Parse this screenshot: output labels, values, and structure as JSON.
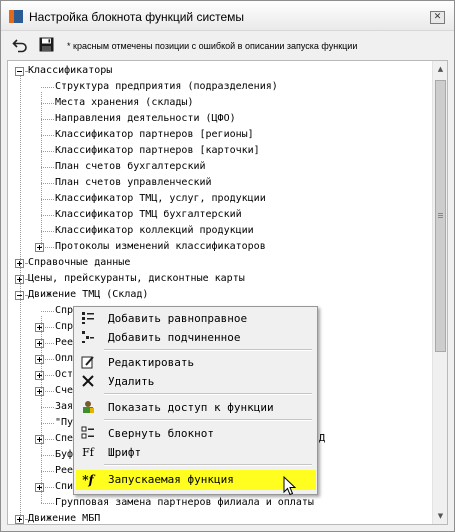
{
  "window": {
    "title": "Настройка блокнота функций системы",
    "close_glyph": "✕"
  },
  "toolbar": {
    "undo_icon": "undo-icon",
    "save_icon": "floppy-disk-icon",
    "hint": "* красным отмечены позиции с ошибкой в описании запуска функции"
  },
  "tree": {
    "items": [
      {
        "label": "Классификаторы",
        "level": 0,
        "expander": "minus"
      },
      {
        "label": "Структура предприятия (подразделения)",
        "level": 1,
        "expander": "none"
      },
      {
        "label": "Места хранения (склады)",
        "level": 1,
        "expander": "none"
      },
      {
        "label": "Направления деятельности (ЦФО)",
        "level": 1,
        "expander": "none"
      },
      {
        "label": "Классификатор партнеров [регионы]",
        "level": 1,
        "expander": "none"
      },
      {
        "label": "Классификатор партнеров [карточки]",
        "level": 1,
        "expander": "none"
      },
      {
        "label": "План счетов бухгалтерский",
        "level": 1,
        "expander": "none"
      },
      {
        "label": "План счетов управленческий",
        "level": 1,
        "expander": "none"
      },
      {
        "label": "Классификатор ТМЦ, услуг, продукции",
        "level": 1,
        "expander": "none"
      },
      {
        "label": "Классификатор ТМЦ бухгалтерский",
        "level": 1,
        "expander": "none"
      },
      {
        "label": "Классификатор коллекций продукции",
        "level": 1,
        "expander": "none"
      },
      {
        "label": "Протоколы изменений классификаторов",
        "level": 1,
        "expander": "plus"
      },
      {
        "label": "Справочные данные",
        "level": 0,
        "expander": "plus"
      },
      {
        "label": "Цены, прейскуранты, дисконтные карты",
        "level": 0,
        "expander": "plus"
      },
      {
        "label": "Движение ТМЦ (Склад)",
        "level": 0,
        "expander": "minus"
      },
      {
        "label": "Спр",
        "level": 1,
        "expander": "none"
      },
      {
        "label": "Спр",
        "level": 1,
        "expander": "plus"
      },
      {
        "label": "Рее",
        "level": 1,
        "expander": "plus"
      },
      {
        "label": "Опл",
        "level": 1,
        "expander": "plus"
      },
      {
        "label": "Ост",
        "level": 1,
        "expander": "plus"
      },
      {
        "label": "Сче",
        "level": 1,
        "expander": "plus"
      },
      {
        "label": "Зая",
        "level": 1,
        "expander": "none"
      },
      {
        "label": "\"Пу",
        "level": 1,
        "expander": "none"
      },
      {
        "label": "Спе",
        "level": 1,
        "expander": "plus"
      },
      {
        "label": "Буф",
        "level": 1,
        "expander": "none"
      },
      {
        "label": "Рее",
        "level": 1,
        "expander": "none"
      },
      {
        "label": "Спи",
        "level": 1,
        "expander": "plus"
      },
      {
        "label": "Групповая замена партнеров филиала и оплаты",
        "level": 1,
        "expander": "none"
      },
      {
        "label": "Движение МБП",
        "level": 0,
        "expander": "plus"
      }
    ],
    "partial_text_behind_menu": "Д"
  },
  "context_menu": {
    "items": [
      {
        "label": "Добавить равноправное",
        "icon": "add-sibling-icon"
      },
      {
        "label": "Добавить подчиненное",
        "icon": "add-child-icon"
      },
      {
        "label": "Редактировать",
        "icon": "edit-icon"
      },
      {
        "label": "Удалить",
        "icon": "delete-icon"
      },
      {
        "label": "Показать доступ к функции",
        "icon": "user-access-icon"
      },
      {
        "label": "Свернуть блокнот",
        "icon": "collapse-tree-icon"
      },
      {
        "label": "Шрифт",
        "icon": "font-icon"
      },
      {
        "label": "Запускаемая функция",
        "icon": "function-icon",
        "highlighted": true
      }
    ],
    "highlight_color": "#fffe1f"
  }
}
